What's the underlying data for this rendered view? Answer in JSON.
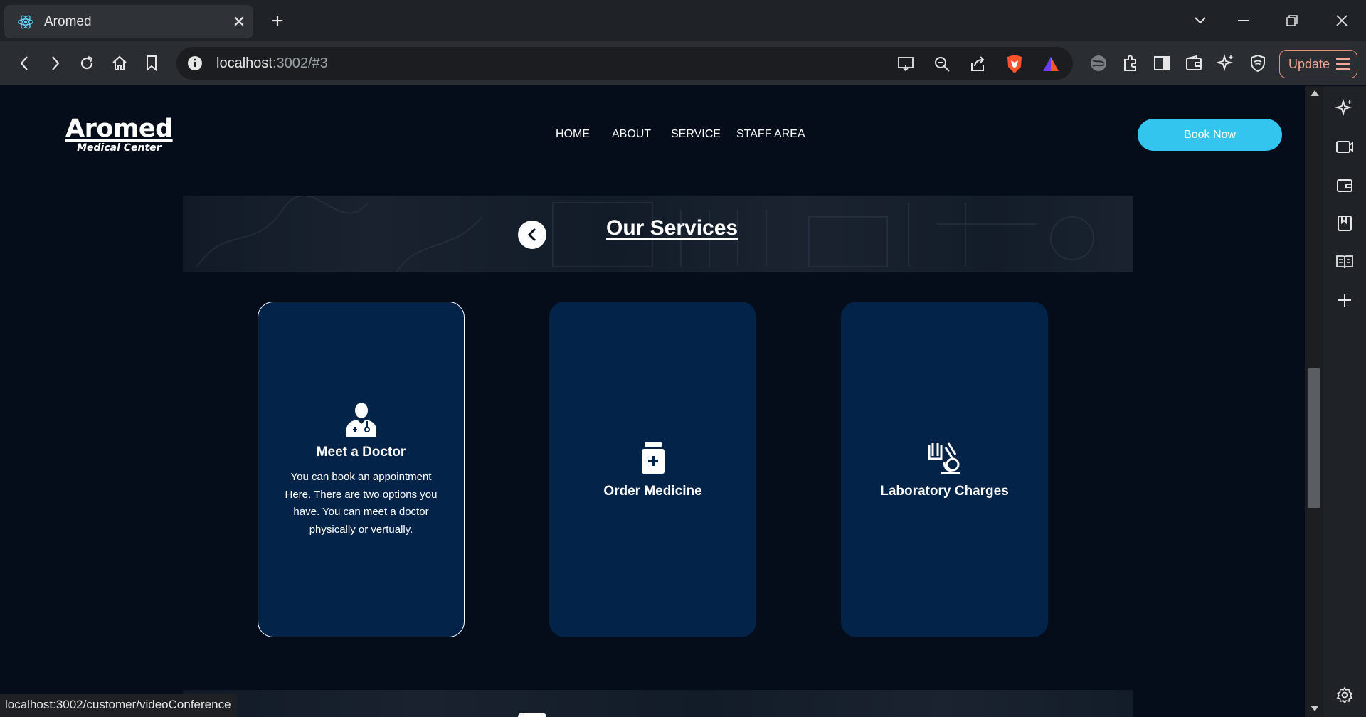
{
  "browser": {
    "tab_title": "Aromed",
    "url_host": "localhost",
    "url_rest": ":3002/#3",
    "update_label": "Update",
    "status_url": "localhost:3002/customer/videoConference"
  },
  "header": {
    "logo_name": "Aromed",
    "logo_sub": "Medical Center",
    "nav": [
      "HOME",
      "ABOUT",
      "SERVICE",
      "STAFF AREA"
    ],
    "book_label": "Book Now"
  },
  "services": {
    "title": "Our Services",
    "cards": [
      {
        "title": "Meet a Doctor",
        "description": "You can book an appointment Here. There are two options you have. You can meet a doctor physically or vertually.",
        "icon": "doctor-icon"
      },
      {
        "title": "Order Medicine",
        "description": "",
        "icon": "medicine-bottle-icon"
      },
      {
        "title": "Laboratory Charges",
        "description": "",
        "icon": "microscope-icon"
      }
    ]
  },
  "colors": {
    "page_bg": "#050d1a",
    "card_bg": "#032448",
    "accent": "#33c5ed"
  }
}
